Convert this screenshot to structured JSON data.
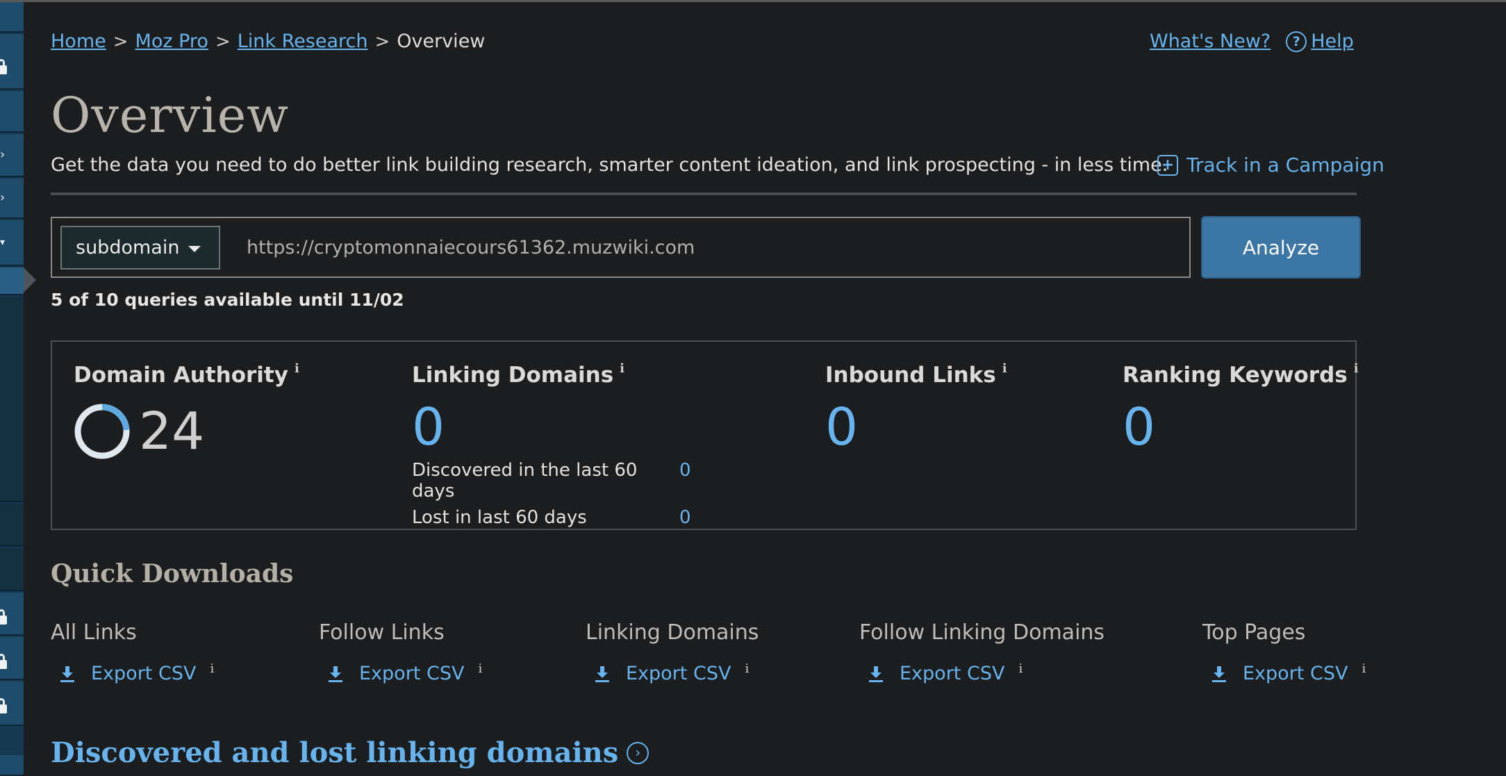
{
  "breadcrumb": {
    "items": [
      "Home",
      "Moz Pro",
      "Link Research"
    ],
    "current": "Overview",
    "separator": ">"
  },
  "top_links": {
    "whats_new": "What's New?",
    "help": "Help",
    "help_icon": "question-circle-icon"
  },
  "page": {
    "title": "Overview",
    "subtitle": "Get the data you need to do better link building research, smarter content ideation, and link prospecting - in less time.",
    "track_label": "Track in a Campaign",
    "track_icon": "plus-square-icon"
  },
  "search": {
    "scope": "subdomain",
    "url_value": "https://cryptomonnaiecours61362.muzwiki.com",
    "analyze_label": "Analyze",
    "quota": "5 of 10 queries available until 11/02"
  },
  "metrics": {
    "domain_authority": {
      "label": "Domain Authority",
      "value": "24",
      "fraction": 0.24
    },
    "linking_domains": {
      "label": "Linking Domains",
      "value": "0",
      "discovered_label": "Discovered in the last 60 days",
      "discovered_value": "0",
      "lost_label": "Lost in last 60 days",
      "lost_value": "0"
    },
    "inbound_links": {
      "label": "Inbound Links",
      "value": "0"
    },
    "ranking_keywords": {
      "label": "Ranking Keywords",
      "value": "0"
    },
    "info_glyph": "i"
  },
  "quick_downloads": {
    "title": "Quick Downloads",
    "items": [
      {
        "label": "All Links",
        "action": "Export CSV"
      },
      {
        "label": "Follow Links",
        "action": "Export CSV"
      },
      {
        "label": "Linking Domains",
        "action": "Export CSV"
      },
      {
        "label": "Follow Linking Domains",
        "action": "Export CSV"
      },
      {
        "label": "Top Pages",
        "action": "Export CSV"
      }
    ]
  },
  "section_link": {
    "label": "Discovered and lost linking domains",
    "icon": "chevron-right-circle-icon"
  },
  "colors": {
    "background": "#1b1d1f",
    "link": "#66b3ee",
    "button": "#3c76a5",
    "rail": "#1f4c6b"
  }
}
